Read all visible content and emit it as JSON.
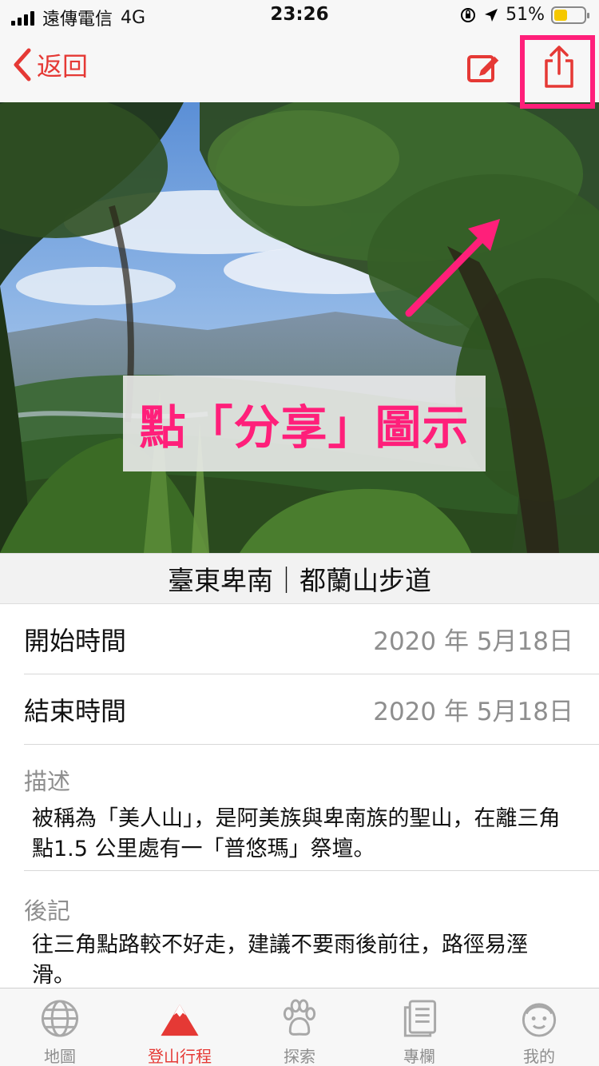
{
  "status_bar": {
    "carrier": "遠傳電信",
    "network": "4G",
    "time": "23:26",
    "battery_percent": "51%",
    "battery_color": "#f5c800"
  },
  "nav": {
    "back_label": "返回",
    "back_icon": "chevron-left-icon",
    "edit_icon": "edit-icon",
    "share_icon": "share-icon",
    "accent_color": "#e53935"
  },
  "annotation": {
    "callout_text": "點「分享」圖示",
    "highlight_color": "#ff1f7a"
  },
  "trail": {
    "title": "臺東卑南｜都蘭山步道"
  },
  "details": {
    "start": {
      "label": "開始時間",
      "value": "2020 年 5月18日"
    },
    "end": {
      "label": "結束時間",
      "value": "2020 年 5月18日"
    }
  },
  "description": {
    "label": "描述",
    "text": "被稱為「美人山」，是阿美族與卑南族的聖山，在離三角點1.5 公里處有一「普悠瑪」祭壇。"
  },
  "notes": {
    "label": "後記",
    "text": "往三角點路較不好走，建議不要雨後前往，路徑易溼滑。"
  },
  "tab_bar": {
    "tabs": [
      {
        "label": "地圖",
        "icon": "globe-icon",
        "active": false
      },
      {
        "label": "登山行程",
        "icon": "mountain-icon",
        "active": true
      },
      {
        "label": "探索",
        "icon": "paw-icon",
        "active": false
      },
      {
        "label": "專欄",
        "icon": "articles-icon",
        "active": false
      },
      {
        "label": "我的",
        "icon": "face-icon",
        "active": false
      }
    ]
  }
}
